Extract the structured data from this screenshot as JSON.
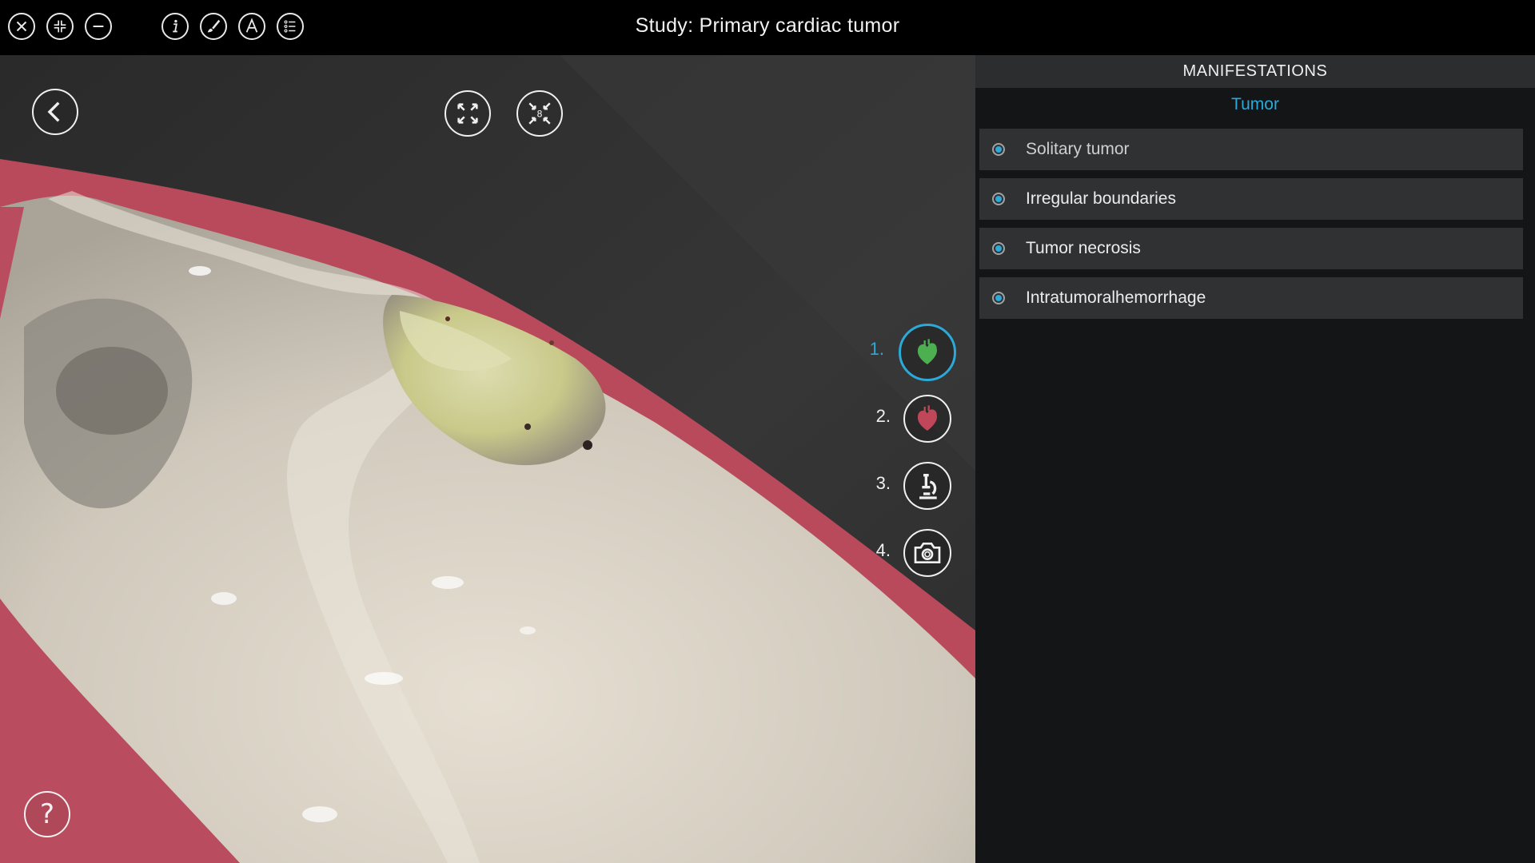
{
  "app": {
    "title": "Study: Primary cardiac tumor"
  },
  "toolbar": {
    "icons": [
      "close-icon",
      "collapse-icon",
      "minus-icon",
      "info-icon",
      "brush-icon",
      "font-icon",
      "list-icon"
    ]
  },
  "viewer": {
    "icons": [
      "back-icon",
      "fullscreen-icon",
      "fit-view-icon",
      "help-icon"
    ],
    "fit_view_badge": "8",
    "help_label": "?",
    "steps": [
      {
        "number": "1.",
        "icon": "heart-icon",
        "color": "#4caf50",
        "active": true
      },
      {
        "number": "2.",
        "icon": "heart-icon",
        "color": "#c0475a",
        "active": false
      },
      {
        "number": "3.",
        "icon": "microscope-icon",
        "active": false
      },
      {
        "number": "4.",
        "icon": "camera-icon",
        "active": false
      }
    ]
  },
  "panel": {
    "header": "MANIFESTATIONS",
    "subheader": "Tumor",
    "items": [
      {
        "label": "Solitary tumor"
      },
      {
        "label": "Irregular boundaries"
      },
      {
        "label": "Tumor necrosis"
      },
      {
        "label": "Intratumoralhemorrhage"
      }
    ]
  },
  "colors": {
    "accent": "#2ba9d8",
    "panel_bg": "#141516",
    "item_bg": "#303133",
    "tissue_red": "#b84a5c",
    "tissue_beige": "#d8d2c6"
  }
}
